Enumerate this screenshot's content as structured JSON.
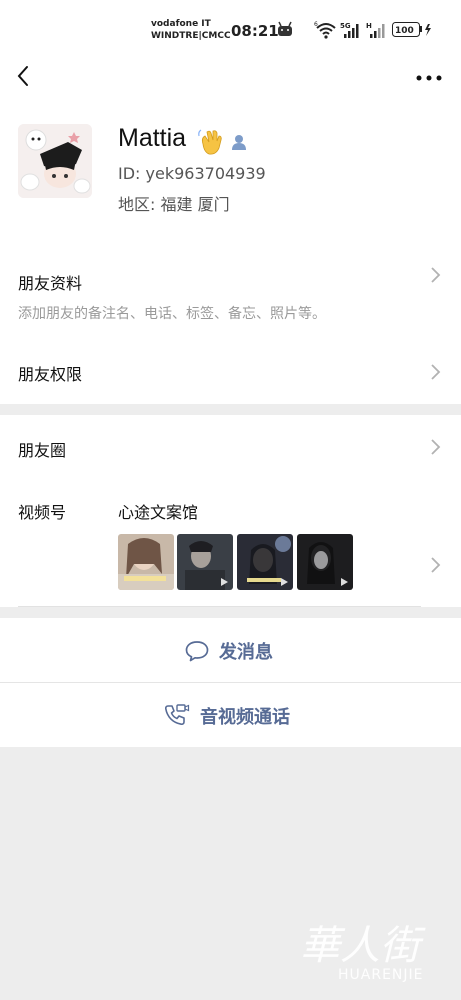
{
  "status_bar": {
    "carrier_line1": "vodafone IT",
    "carrier_line2": "WINDTRE|CMCC",
    "time": "08:21",
    "battery": "100"
  },
  "profile": {
    "name": "Mattia",
    "id_text": "ID:  yek963704939",
    "region_text": "地区:  福建  厦门"
  },
  "rows": {
    "friend_info_title": "朋友资料",
    "friend_info_sub": "添加朋友的备注名、电话、标签、备忘、照片等。",
    "permissions_title": "朋友权限",
    "moments_title": "朋友圈",
    "channels_title": "视频号",
    "channels_name": "心途文案馆"
  },
  "actions": {
    "message": "发消息",
    "call": "音视频通话"
  },
  "watermark": {
    "cn": "華人街",
    "en": "HUARENJIE"
  },
  "colors": {
    "link_blue": "#576b95",
    "background": "#ededed"
  }
}
